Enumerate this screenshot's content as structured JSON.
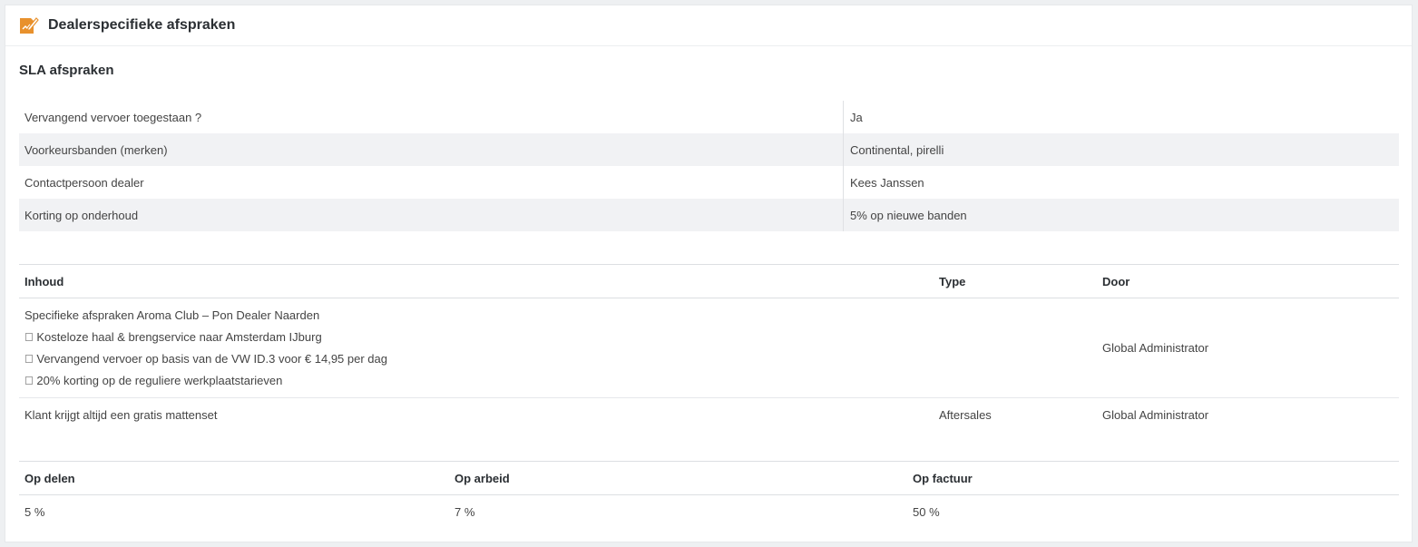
{
  "panel": {
    "title": "Dealerspecifieke afspraken",
    "icon": "edit-document-icon",
    "icon_color": "#e8912d"
  },
  "sla": {
    "title": "SLA afspraken",
    "rows": [
      {
        "key": "Vervangend vervoer toegestaan ?",
        "value": "Ja"
      },
      {
        "key": "Voorkeursbanden (merken)",
        "value": "Continental, pirelli"
      },
      {
        "key": "Contactpersoon dealer",
        "value": "Kees Janssen"
      },
      {
        "key": "Korting op onderhoud",
        "value": "5% op nieuwe banden"
      }
    ]
  },
  "agreements": {
    "headers": {
      "content": "Inhoud",
      "type": "Type",
      "by": "Door"
    },
    "rows": [
      {
        "content_lines": [
          "Specifieke afspraken Aroma Club – Pon Dealer Naarden",
          "\u0000 Kosteloze haal & brengservice naar Amsterdam IJburg",
          "\u0000 Vervangend vervoer op basis van de VW ID.3 voor € 14,95 per dag",
          "\u0000 20% korting op de reguliere werkplaatstarieven"
        ],
        "type": "",
        "by": "Global Administrator"
      },
      {
        "content_lines": [
          "Klant krijgt altijd een gratis mattenset"
        ],
        "type": "Aftersales",
        "by": "Global Administrator"
      }
    ]
  },
  "discounts": {
    "headers": {
      "parts": "Op delen",
      "labor": "Op arbeid",
      "invoice": "Op factuur"
    },
    "values": {
      "parts": "5 %",
      "labor": "7 %",
      "invoice": "50 %"
    }
  }
}
